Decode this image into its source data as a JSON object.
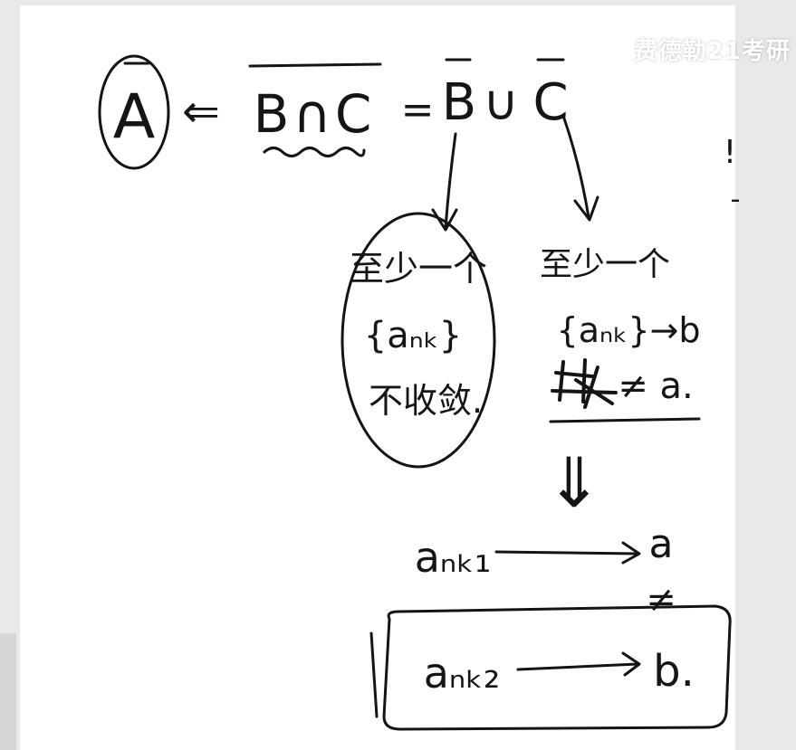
{
  "watermark": "费德勒21考研",
  "equation": {
    "circled_set": "A",
    "implies": "⇐",
    "left_side": "B∩C",
    "equals": "=",
    "right_b": "B",
    "union": "∪",
    "right_c": "C"
  },
  "branch_left": {
    "line1": "至少一个",
    "line2": "{aₙₖ}",
    "line3": "不收敛."
  },
  "branch_right": {
    "line1": "至少一个",
    "line2": "{aₙₖ}→b",
    "line3": "≠ a."
  },
  "conclusion": {
    "implies": "⇓",
    "seq1": "aₙₖ₁",
    "limit1": "a",
    "not_equal": "≠",
    "seq2": "aₙₖ₂",
    "limit2": "b."
  },
  "margin_marks": [
    "!",
    "-"
  ]
}
